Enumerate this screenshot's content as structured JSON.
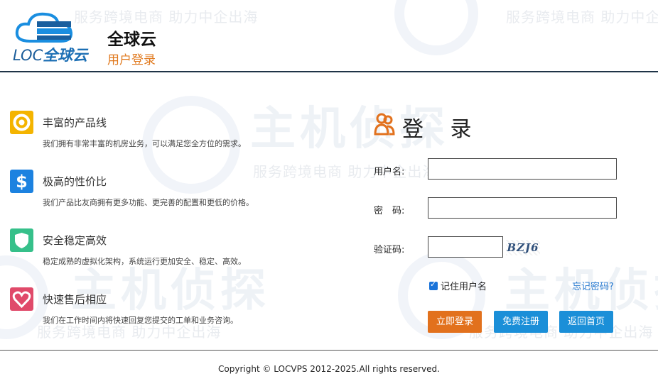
{
  "header": {
    "logo_en": "LOC",
    "logo_cn": "全球云",
    "title": "全球云",
    "subtitle": "用户登录"
  },
  "watermark": {
    "slogan": "服务跨境电商 助力中企出海",
    "brand": "主机侦探"
  },
  "features": [
    {
      "icon": "lifebuoy-icon",
      "color": "#f4b400",
      "title": "丰富的产品线",
      "desc": "我们拥有非常丰富的机房业务，可以满足您全方位的需求。"
    },
    {
      "icon": "dollar-icon",
      "color": "#1c82e0",
      "title": "极高的性价比",
      "desc": "我们产品比友商拥有更多功能、更完善的配置和更低的价格。"
    },
    {
      "icon": "shield-icon",
      "color": "#36c08a",
      "title": "安全稳定高效",
      "desc": "稳定成熟的虚拟化架构，系统运行更加安全、稳定、高效。"
    },
    {
      "icon": "heart-icon",
      "color": "#e04a6a",
      "title": "快速售后相应",
      "desc": "我们在工作时间内将快速回复您提交的工单和业务咨询。"
    }
  ],
  "login": {
    "title": "登 录",
    "username_label": "用户名:",
    "password_label": "密　码:",
    "captcha_label": "验证码:",
    "captcha_text": "BZJ6",
    "remember_label": "记住用户名",
    "remember_checked": true,
    "forgot_label": "忘记密码?",
    "login_button": "立即登录",
    "register_button": "免费注册",
    "home_button": "返回首页"
  },
  "footer": {
    "copyright": "Copyright © LOCVPS 2012-2025.All rights reserved."
  }
}
